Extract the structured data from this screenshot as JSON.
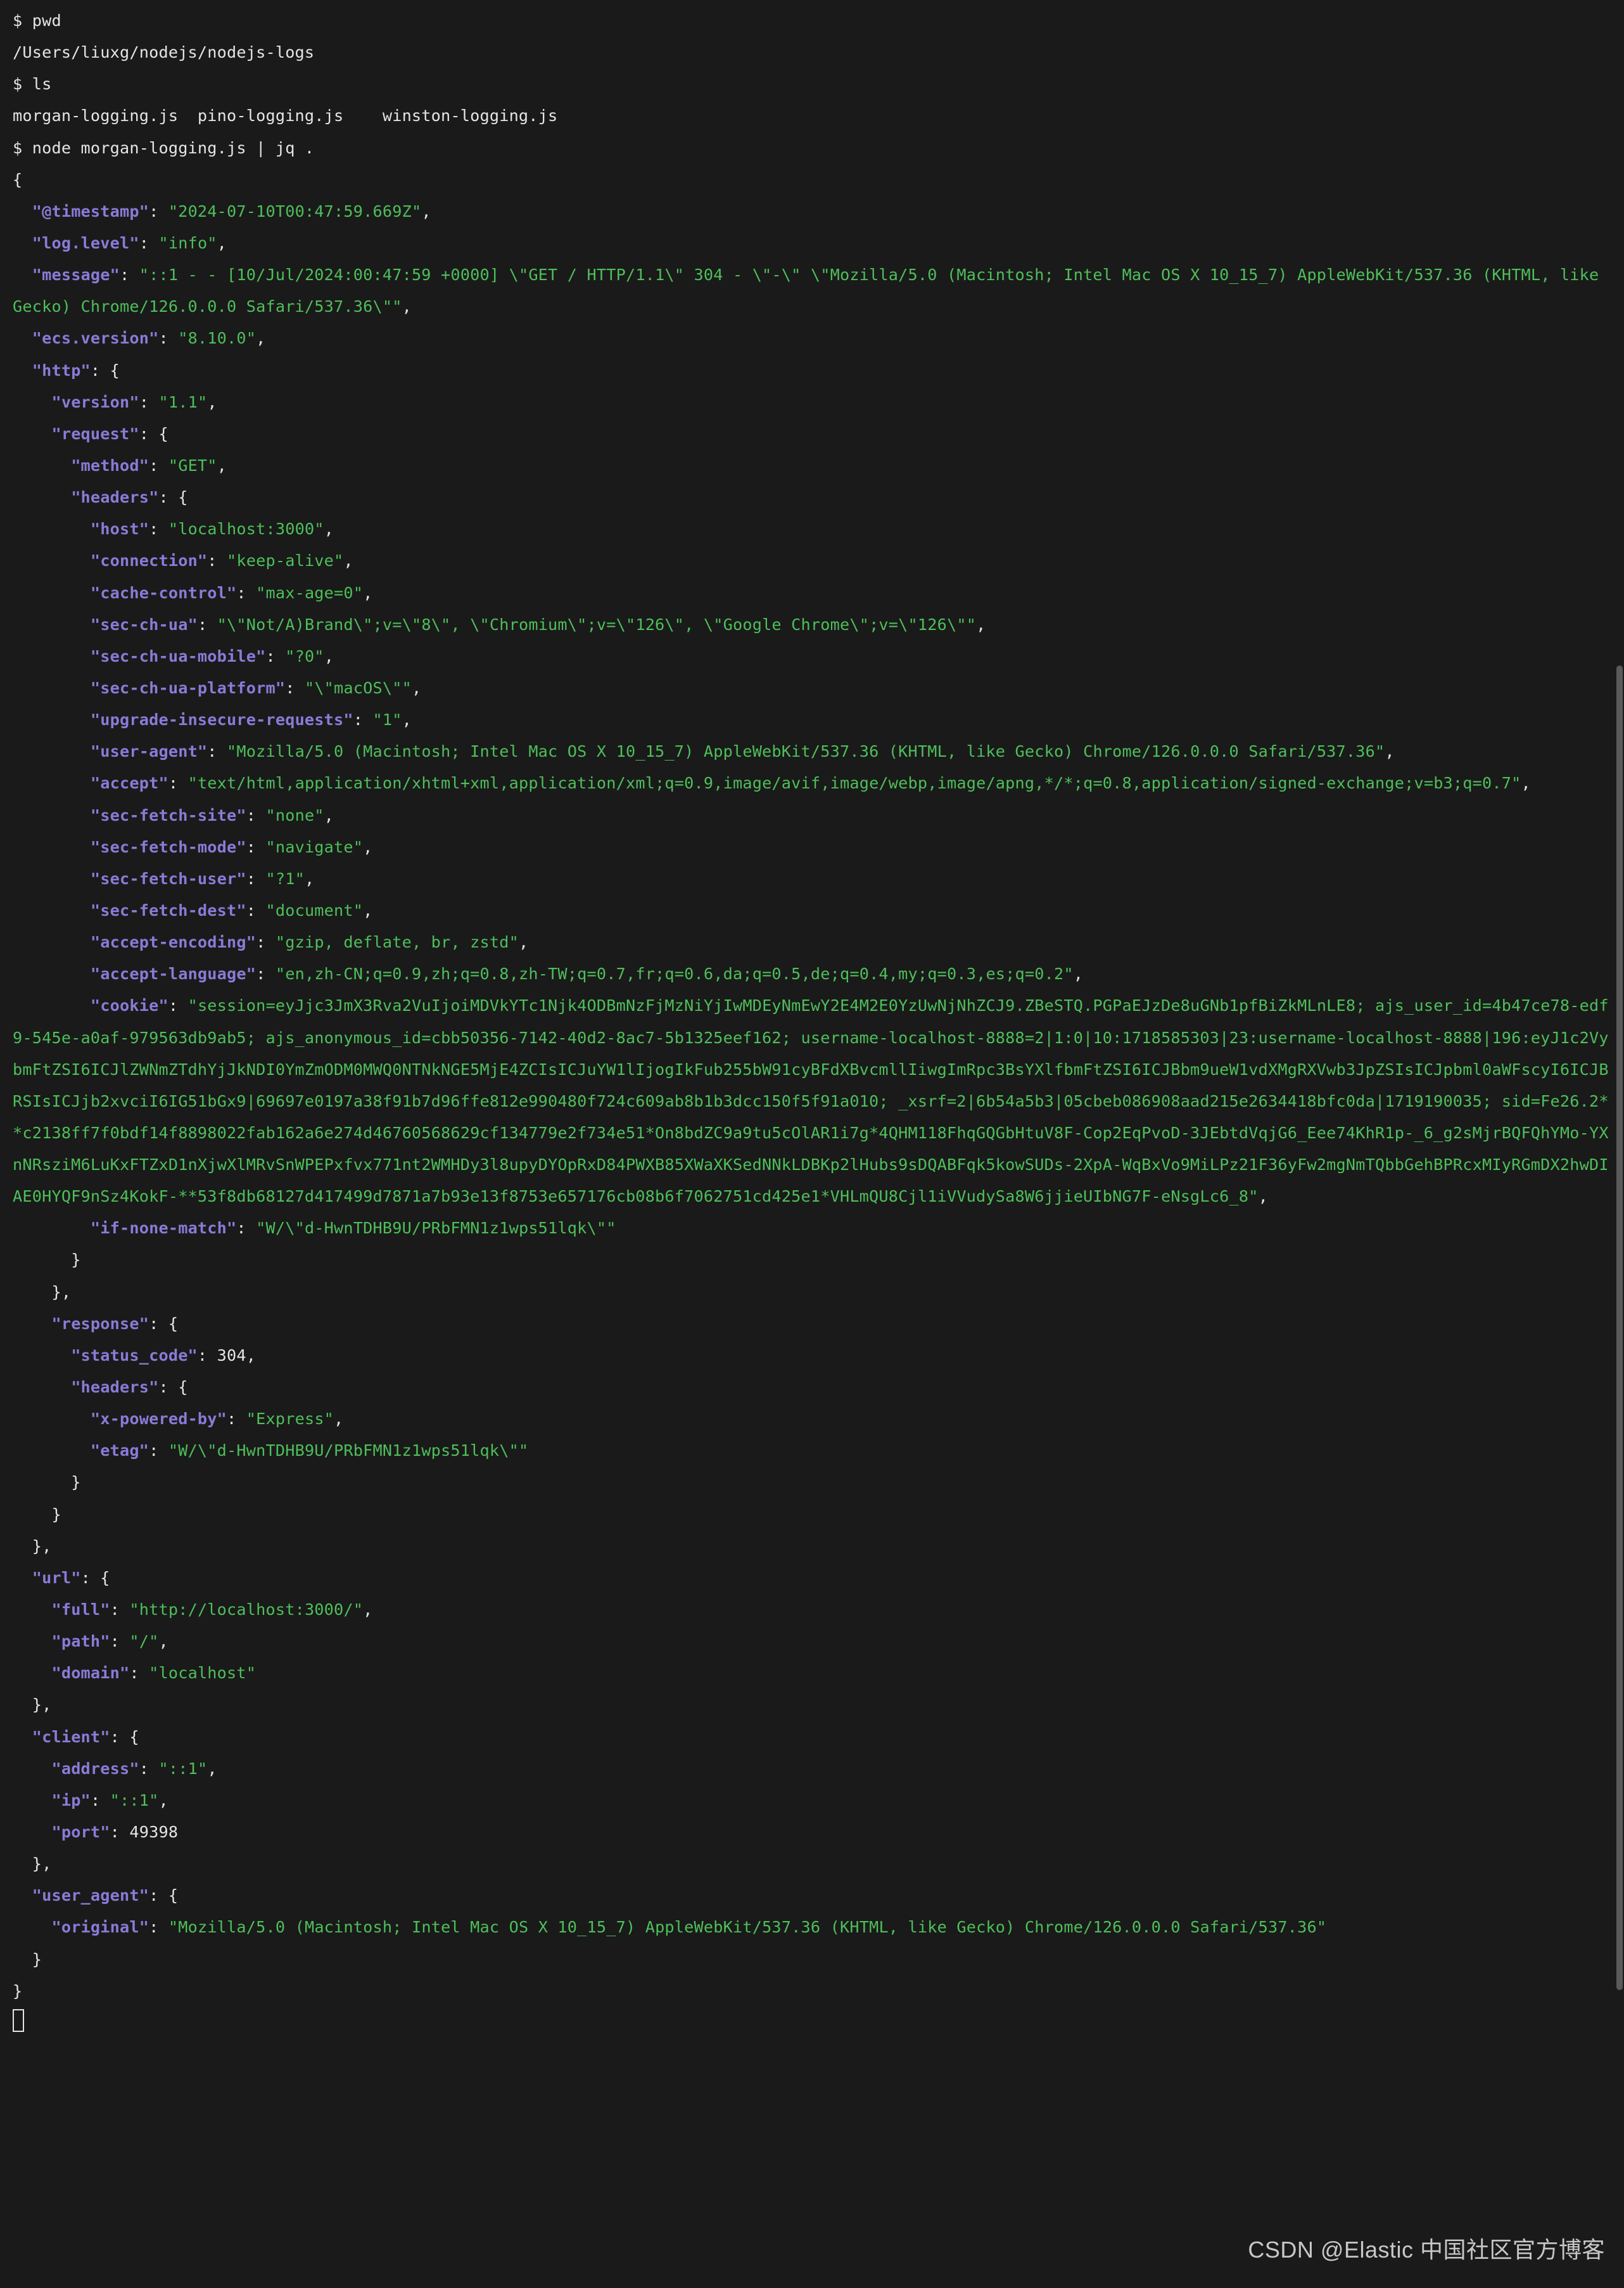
{
  "prompt": "$ ",
  "cmd_pwd": "pwd",
  "pwd_out": "/Users/liuxg/nodejs/nodejs-logs",
  "cmd_ls": "ls",
  "ls_out": "morgan-logging.js  pino-logging.js    winston-logging.js",
  "cmd_node": "node morgan-logging.js | jq .",
  "json": {
    "brace_open": "{",
    "brace_close": "}",
    "brace_close_comma": "},",
    "entries": {
      "timestamp_k": "\"@timestamp\"",
      "timestamp_v": "\"2024-07-10T00:47:59.669Z\"",
      "loglevel_k": "\"log.level\"",
      "loglevel_v": "\"info\"",
      "message_k": "\"message\"",
      "message_v": "\"::1 - - [10/Jul/2024:00:47:59 +0000] \\\"GET / HTTP/1.1\\\" 304 - \\\"-\\\" \\\"Mozilla/5.0 (Macintosh; Intel Mac OS X 10_15_7) AppleWebKit/537.36 (KHTML, like Gecko) Chrome/126.0.0.0 Safari/537.36\\\"\"",
      "ecsversion_k": "\"ecs.version\"",
      "ecsversion_v": "\"8.10.0\"",
      "http_k": "\"http\"",
      "version_k": "\"version\"",
      "version_v": "\"1.1\"",
      "request_k": "\"request\"",
      "method_k": "\"method\"",
      "method_v": "\"GET\"",
      "headers_k": "\"headers\"",
      "host_k": "\"host\"",
      "host_v": "\"localhost:3000\"",
      "connection_k": "\"connection\"",
      "connection_v": "\"keep-alive\"",
      "cachecontrol_k": "\"cache-control\"",
      "cachecontrol_v": "\"max-age=0\"",
      "secchua_k": "\"sec-ch-ua\"",
      "secchua_v": "\"\\\"Not/A)Brand\\\";v=\\\"8\\\", \\\"Chromium\\\";v=\\\"126\\\", \\\"Google Chrome\\\";v=\\\"126\\\"\"",
      "secchuamobile_k": "\"sec-ch-ua-mobile\"",
      "secchuamobile_v": "\"?0\"",
      "secchuaplatform_k": "\"sec-ch-ua-platform\"",
      "secchuaplatform_v": "\"\\\"macOS\\\"\"",
      "upgrade_k": "\"upgrade-insecure-requests\"",
      "upgrade_v": "\"1\"",
      "useragent_k": "\"user-agent\"",
      "useragent_v": "\"Mozilla/5.0 (Macintosh; Intel Mac OS X 10_15_7) AppleWebKit/537.36 (KHTML, like Gecko) Chrome/126.0.0.0 Safari/537.36\"",
      "accept_k": "\"accept\"",
      "accept_v": "\"text/html,application/xhtml+xml,application/xml;q=0.9,image/avif,image/webp,image/apng,*/*;q=0.8,application/signed-exchange;v=b3;q=0.7\"",
      "sfs_k": "\"sec-fetch-site\"",
      "sfs_v": "\"none\"",
      "sfm_k": "\"sec-fetch-mode\"",
      "sfm_v": "\"navigate\"",
      "sfu_k": "\"sec-fetch-user\"",
      "sfu_v": "\"?1\"",
      "sfd_k": "\"sec-fetch-dest\"",
      "sfd_v": "\"document\"",
      "ae_k": "\"accept-encoding\"",
      "ae_v": "\"gzip, deflate, br, zstd\"",
      "al_k": "\"accept-language\"",
      "al_v": "\"en,zh-CN;q=0.9,zh;q=0.8,zh-TW;q=0.7,fr;q=0.6,da;q=0.5,de;q=0.4,my;q=0.3,es;q=0.2\"",
      "cookie_k": "\"cookie\"",
      "cookie_v": "\"session=eyJjc3JmX3Rva2VuIjoiMDVkYTc1Njk4ODBmNzFjMzNiYjIwMDEyNmEwY2E4M2E0YzUwNjNhZCJ9.ZBeSTQ.PGPaEJzDe8uGNb1pfBiZkMLnLE8; ajs_user_id=4b47ce78-edf9-545e-a0af-979563db9ab5; ajs_anonymous_id=cbb50356-7142-40d2-8ac7-5b1325eef162; username-localhost-8888=2|1:0|10:1718585303|23:username-localhost-8888|196:eyJ1c2VybmFtZSI6ICJlZWNmZTdhYjJkNDI0YmZmODM0MWQ0NTNkNGE5MjE4ZCIsICJuYW1lIjogIkFub255bW91cyBFdXBvcmllIiwgImRpc3BsYXlfbmFtZSI6ICJBbm9ueW1vdXMgRXVwb3JpZSIsICJpbml0aWFscyI6ICJBRSIsICJjb2xvciI6IG51bGx9|69697e0197a38f91b7d96ffe812e990480f724c609ab8b1b3dcc150f5f91a010; _xsrf=2|6b54a5b3|05cbeb086908aad215e2634418bfc0da|1719190035; sid=Fe26.2**c2138ff7f0bdf14f8898022fab162a6e274d46760568629cf134779e2f734e51*On8bdZC9a9tu5cOlAR1i7g*4QHM118FhqGQGbHtuV8F-Cop2EqPvoD-3JEbtdVqjG6_Eee74KhR1p-_6_g2sMjrBQFQhYMo-YXnNRsziM6LuKxFTZxD1nXjwXlMRvSnWPEPxfvx771nt2WMHDy3l8upyDYOpRxD84PWXB85XWaXKSedNNkLDBKp2lHubs9sDQABFqk5kowSUDs-2XpA-WqBxVo9MiLPz21F36yFw2mgNmTQbbGehBPRcxMIyRGmDX2hwDIAE0HYQF9nSz4KokF-**53f8db68127d417499d7871a7b93e13f8753e657176cb08b6f7062751cd425e1*VHLmQU8Cjl1iVVudySa8W6jjieUIbNG7F-eNsgLc6_8\"",
      "inm_k": "\"if-none-match\"",
      "inm_v": "\"W/\\\"d-HwnTDHB9U/PRbFMN1z1wps51lqk\\\"\"",
      "response_k": "\"response\"",
      "status_k": "\"status_code\"",
      "status_v": "304",
      "xpb_k": "\"x-powered-by\"",
      "xpb_v": "\"Express\"",
      "etag_k": "\"etag\"",
      "etag_v": "\"W/\\\"d-HwnTDHB9U/PRbFMN1z1wps51lqk\\\"\"",
      "url_k": "\"url\"",
      "full_k": "\"full\"",
      "full_v": "\"http://localhost:3000/\"",
      "path_k": "\"path\"",
      "path_v": "\"/\"",
      "domain_k": "\"domain\"",
      "domain_v": "\"localhost\"",
      "client_k": "\"client\"",
      "address_k": "\"address\"",
      "address_v": "\"::1\"",
      "ip_k": "\"ip\"",
      "ip_v": "\"::1\"",
      "port_k": "\"port\"",
      "port_v": "49398",
      "useragent2_k": "\"user_agent\"",
      "original_k": "\"original\"",
      "original_v": "\"Mozilla/5.0 (Macintosh; Intel Mac OS X 10_15_7) AppleWebKit/537.36 (KHTML, like Gecko) Chrome/126.0.0.0 Safari/537.36\""
    }
  },
  "watermark": "CSDN @Elastic 中国社区官方博客"
}
